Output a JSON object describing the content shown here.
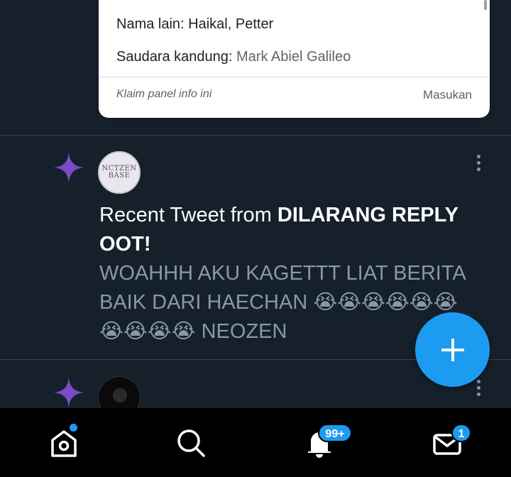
{
  "info_panel": {
    "other_names_label": "Nama lain:",
    "other_names_value": "Haikal, Petter",
    "sibling_label": "Saudara kandung:",
    "sibling_value": "Mark Abiel Galileo",
    "claim_label": "Klaim panel info ini",
    "feedback_label": "Masukan"
  },
  "tweet": {
    "intro": "Recent Tweet from ",
    "author": "DILARANG REPLY OOT!",
    "body": "WOAHHH AKU KAGETTT LIAT BERITA BAIK DARI HAECHAN 😭😭😭😭😭😭😭😭😭😭 NEOZEN",
    "avatar_logo_line1": "NCTZEN",
    "avatar_logo_line2": "BASE"
  },
  "bottom_nav": {
    "notifications_badge": "99+",
    "messages_badge": "1",
    "icons": [
      "home-icon",
      "search-icon",
      "bell-icon",
      "mail-icon"
    ]
  },
  "colors": {
    "background": "#15202b",
    "accent": "#1d9bf0",
    "sparkle": "#794bc4",
    "muted_text": "#8899a6"
  }
}
